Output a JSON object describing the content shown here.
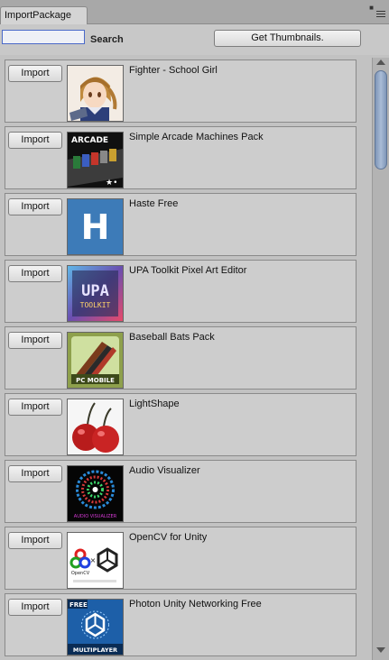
{
  "window": {
    "tab_title": "ImportPackage",
    "menu_glyph": "▪≡"
  },
  "toolbar": {
    "search_value": "",
    "search_label": "Search",
    "thumbnails_button": "Get Thumbnails."
  },
  "packages": [
    {
      "import_label": "Import",
      "name": "Fighter - School Girl",
      "thumb_icon": "anime-girl-thumbnail"
    },
    {
      "import_label": "Import",
      "name": "Simple Arcade Machines Pack",
      "thumb_icon": "arcade-machines-thumbnail",
      "thumb_text": "ARCADE"
    },
    {
      "import_label": "Import",
      "name": "Haste Free",
      "thumb_icon": "letter-h-thumbnail",
      "thumb_text": "H"
    },
    {
      "import_label": "Import",
      "name": "UPA Toolkit Pixel Art Editor",
      "thumb_icon": "upa-toolkit-thumbnail",
      "thumb_text": "UPA",
      "thumb_subtext": "TOOLKIT"
    },
    {
      "import_label": "Import",
      "name": "Baseball Bats Pack",
      "thumb_icon": "baseball-bats-thumbnail",
      "thumb_text": "PC MOBILE"
    },
    {
      "import_label": "Import",
      "name": "LightShape",
      "thumb_icon": "cherries-thumbnail"
    },
    {
      "import_label": "Import",
      "name": "Audio Visualizer",
      "thumb_icon": "audio-visualizer-thumbnail",
      "thumb_text": "AUDIO VISUALIZER"
    },
    {
      "import_label": "Import",
      "name": "OpenCV for Unity",
      "thumb_icon": "opencv-unity-thumbnail",
      "thumb_text": "OpenCV"
    },
    {
      "import_label": "Import",
      "name": "Photon Unity Networking Free",
      "thumb_icon": "photon-multiplayer-thumbnail",
      "thumb_text": "FREE",
      "thumb_subtext": "MULTIPLAYER"
    }
  ],
  "colors": {
    "search_border": "#4a69c8",
    "scroll_thumb": "#8fa6c8",
    "panel_bg": "#cdcdcd"
  }
}
